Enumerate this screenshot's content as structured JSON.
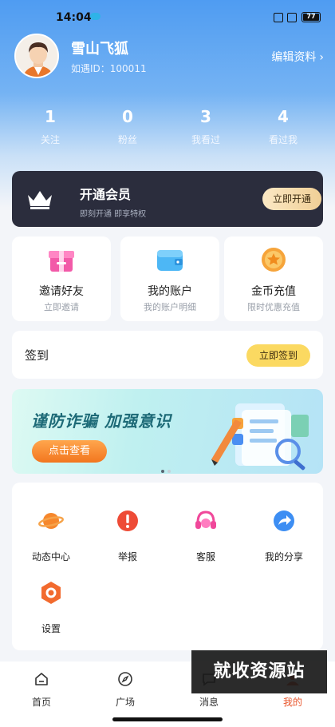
{
  "status_bar": {
    "time": "14:04",
    "battery": "77"
  },
  "profile": {
    "name": "雪山飞狐",
    "id_text": "如遇ID：100011",
    "edit_label": "编辑资料",
    "edit_chevron": "›"
  },
  "stats": [
    {
      "value": "1",
      "label": "关注"
    },
    {
      "value": "0",
      "label": "粉丝"
    },
    {
      "value": "3",
      "label": "我看过"
    },
    {
      "value": "4",
      "label": "看过我"
    }
  ],
  "vip": {
    "title": "开通会员",
    "subtitle": "即刻开通 即享特权",
    "button": "立即开通"
  },
  "cards": [
    {
      "title": "邀请好友",
      "subtitle": "立即邀请",
      "icon": "gift-box-icon"
    },
    {
      "title": "我的账户",
      "subtitle": "我的账户明细",
      "icon": "wallet-icon"
    },
    {
      "title": "金币充值",
      "subtitle": "限时优惠充值",
      "icon": "gold-coin-icon"
    }
  ],
  "signin": {
    "label": "签到",
    "button": "立即签到"
  },
  "banner": {
    "headline": "谨防诈骗 加强意识",
    "button": "点击查看",
    "page_count": 2,
    "current_page": 1
  },
  "menu": [
    {
      "label": "动态中心",
      "icon": "planet-icon"
    },
    {
      "label": "举报",
      "icon": "alert-icon"
    },
    {
      "label": "客服",
      "icon": "headset-icon"
    },
    {
      "label": "我的分享",
      "icon": "share-icon"
    },
    {
      "label": "设置",
      "icon": "settings-icon"
    }
  ],
  "tabbar": [
    {
      "label": "首页",
      "icon": "home-icon"
    },
    {
      "label": "广场",
      "icon": "compass-icon"
    },
    {
      "label": "消息",
      "icon": "message-icon"
    },
    {
      "label": "我的",
      "icon": "user-icon",
      "active": true
    }
  ],
  "watermark": "就收资源站",
  "colors": {
    "accent": "#e8552b",
    "header_blue": "#4f9cf2",
    "vip_bg": "#2b2d3d",
    "signin_btn": "#fbd961"
  }
}
